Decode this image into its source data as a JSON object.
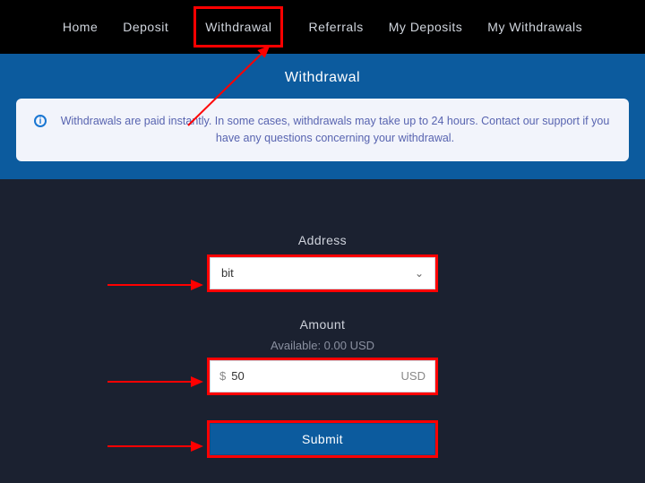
{
  "nav": {
    "home": "Home",
    "deposit": "Deposit",
    "withdrawal": "Withdrawal",
    "referrals": "Referrals",
    "my_deposits": "My Deposits",
    "my_withdrawals": "My Withdrawals"
  },
  "page": {
    "title": "Withdrawal",
    "notice": "Withdrawals are paid instantly. In some cases, withdrawals may take up to 24 hours. Contact our support if you have any questions concerning your withdrawal."
  },
  "form": {
    "address_label": "Address",
    "address_value": "bit",
    "amount_label": "Amount",
    "available_text": "Available: 0.00 USD",
    "amount_prefix": "$",
    "amount_value": "50",
    "amount_suffix": "USD",
    "submit_label": "Submit"
  },
  "colors": {
    "highlight": "#ff0000",
    "brand_blue": "#0c5b9e",
    "bg_dark": "#1b2130"
  }
}
